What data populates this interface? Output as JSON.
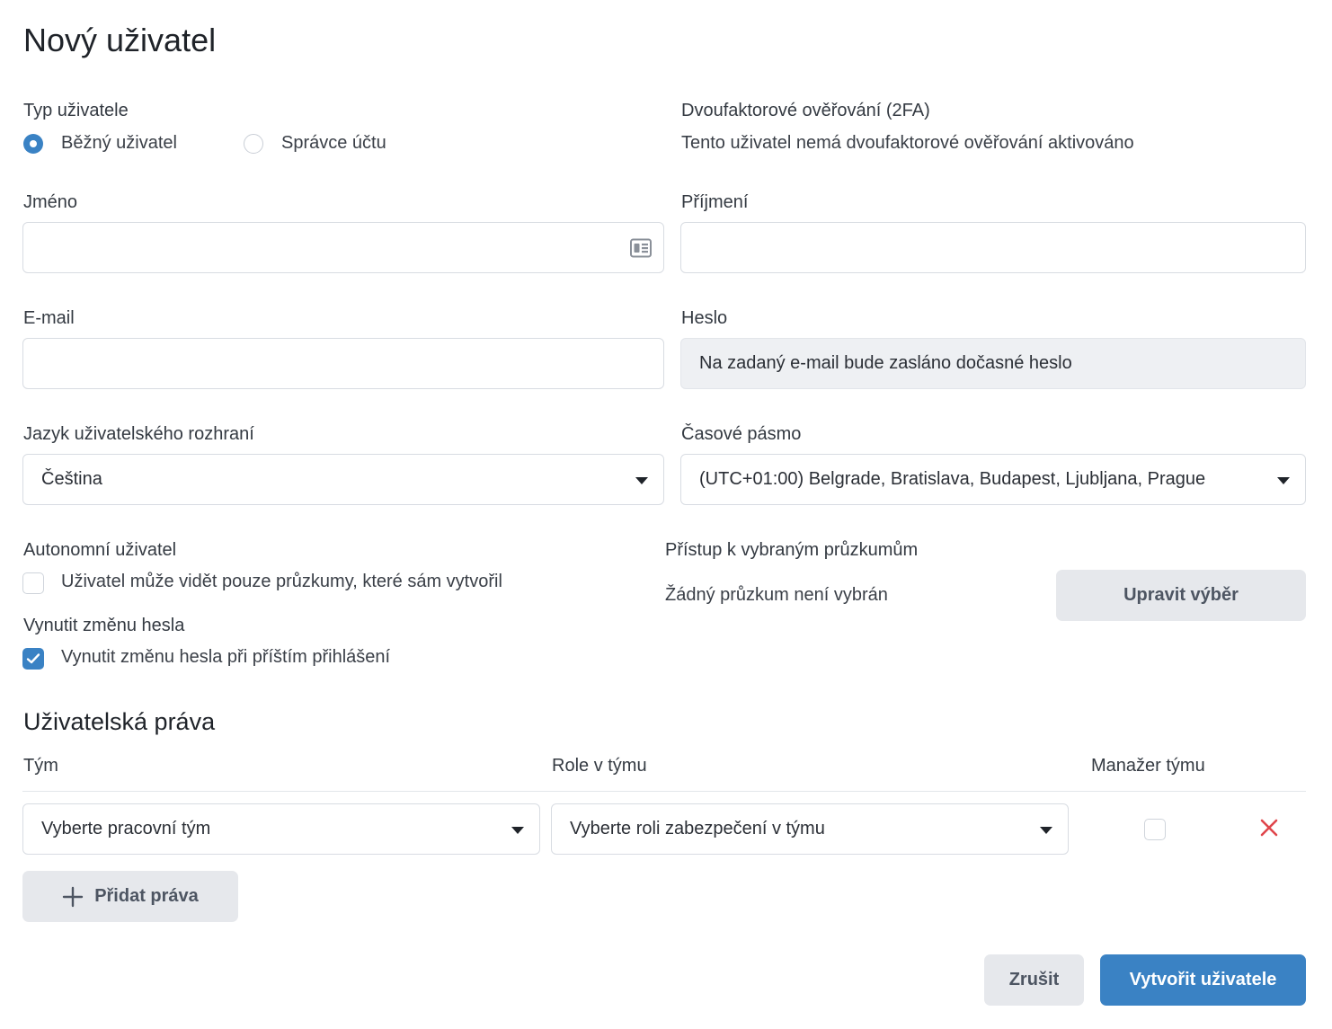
{
  "page": {
    "title": "Nový uživatel"
  },
  "user_type": {
    "label": "Typ uživatele",
    "options": [
      {
        "label": "Běžný uživatel",
        "selected": true
      },
      {
        "label": "Správce účtu",
        "selected": false
      }
    ]
  },
  "two_fa": {
    "label": "Dvoufaktorové ověřování (2FA)",
    "status": "Tento uživatel nemá dvoufaktorové ověřování aktivováno"
  },
  "first_name": {
    "label": "Jméno",
    "value": ""
  },
  "last_name": {
    "label": "Příjmení",
    "value": ""
  },
  "email": {
    "label": "E-mail",
    "value": ""
  },
  "password": {
    "label": "Heslo",
    "value": "Na zadaný e-mail bude zasláno dočasné heslo"
  },
  "language": {
    "label": "Jazyk uživatelského rozhraní",
    "value": "Čeština"
  },
  "timezone": {
    "label": "Časové pásmo",
    "value": "(UTC+01:00) Belgrade, Bratislava, Budapest, Ljubljana, Prague"
  },
  "autonomous": {
    "label": "Autonomní uživatel",
    "checkbox_label": "Uživatel může vidět pouze průzkumy, které sám vytvořil",
    "checked": false
  },
  "survey_access": {
    "label": "Přístup k vybraným průzkumům",
    "status": "Žádný průzkum není vybrán",
    "button_label": "Upravit výběr"
  },
  "force_password": {
    "label": "Vynutit změnu hesla",
    "checkbox_label": "Vynutit změnu hesla při příštím přihlášení",
    "checked": true
  },
  "rights": {
    "heading": "Uživatelská práva",
    "columns": {
      "team": "Tým",
      "role": "Role v týmu",
      "manager": "Manažer týmu"
    },
    "rows": [
      {
        "team_placeholder": "Vyberte pracovní tým",
        "role_placeholder": "Vyberte roli zabezpečení v týmu",
        "manager": false
      }
    ],
    "add_button_label": "Přidat práva"
  },
  "footer": {
    "cancel_label": "Zrušit",
    "create_label": "Vytvořit uživatele"
  },
  "colors": {
    "accent": "#3a82c4",
    "danger": "#e0454b",
    "readonly_bg": "#eef0f3",
    "secondary_btn": "#e6e8ec"
  },
  "icons": {
    "name_field": "contact-card-icon",
    "dropdown": "caret-down-icon",
    "remove": "close-x-icon",
    "add": "plus-icon",
    "check": "checkmark-icon"
  }
}
